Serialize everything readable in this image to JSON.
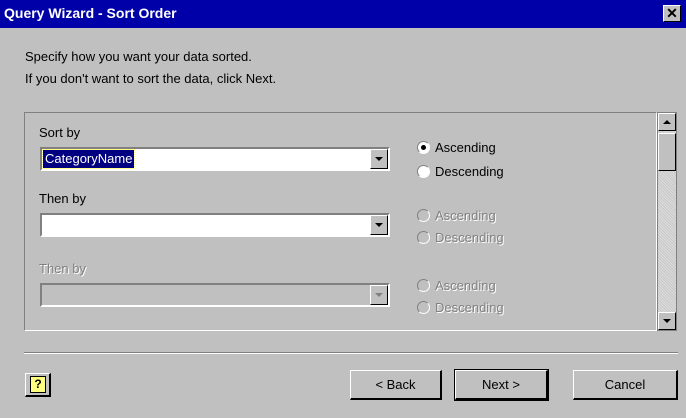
{
  "window": {
    "title": "Query Wizard - Sort Order",
    "close_label": "✕"
  },
  "instructions": {
    "line1": "Specify how you want your data sorted.",
    "line2": "If you don't want to sort the data, click Next."
  },
  "sort_rows": [
    {
      "label": "Sort by",
      "value": "CategoryName",
      "ascending": "Ascending",
      "descending": "Descending",
      "selected": "ascending",
      "enabled": true
    },
    {
      "label": "Then by",
      "value": "",
      "ascending": "Ascending",
      "descending": "Descending",
      "selected": "none",
      "enabled": true
    },
    {
      "label": "Then by",
      "value": "",
      "ascending": "Ascending",
      "descending": "Descending",
      "selected": "none",
      "enabled": false
    }
  ],
  "buttons": {
    "help": "?",
    "back": "< Back",
    "next": "Next >",
    "cancel": "Cancel"
  }
}
